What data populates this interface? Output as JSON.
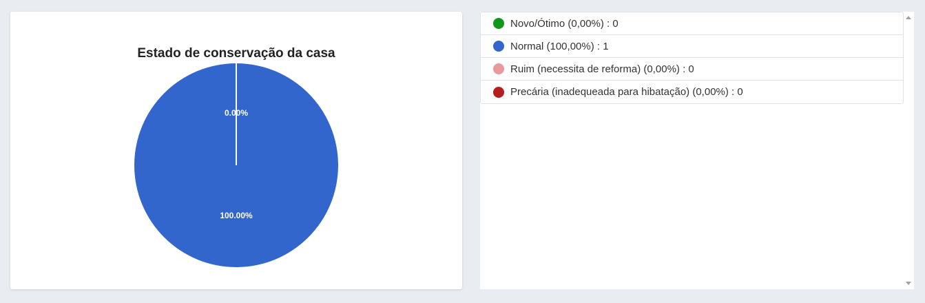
{
  "chart_data": {
    "type": "pie",
    "title": "Estado de conservação da casa",
    "slices": [
      {
        "label": "Novo/Ótimo",
        "value": 0,
        "percent": "0,00%",
        "color": "#109618"
      },
      {
        "label": "Normal",
        "value": 1,
        "percent": "100,00%",
        "color": "#3366cc"
      },
      {
        "label": "Ruim (necessita de reforma)",
        "value": 0,
        "percent": "0,00%",
        "color": "#e89a9a"
      },
      {
        "label": "Precária (inadequeada para hibatação)",
        "value": 0,
        "percent": "0,00%",
        "color": "#b41e1e"
      }
    ],
    "data_labels": [
      "0.00%",
      "100.00%"
    ]
  },
  "legend": {
    "items": [
      "Novo/Ótimo (0,00%) : 0",
      "Normal (100,00%) : 1",
      "Ruim (necessita de reforma) (0,00%) : 0",
      "Precária (inadequeada para hibatação) (0,00%) : 0"
    ]
  },
  "colors": {
    "pie_fill": "#3366cc",
    "slice_separator": "#ffffff"
  }
}
